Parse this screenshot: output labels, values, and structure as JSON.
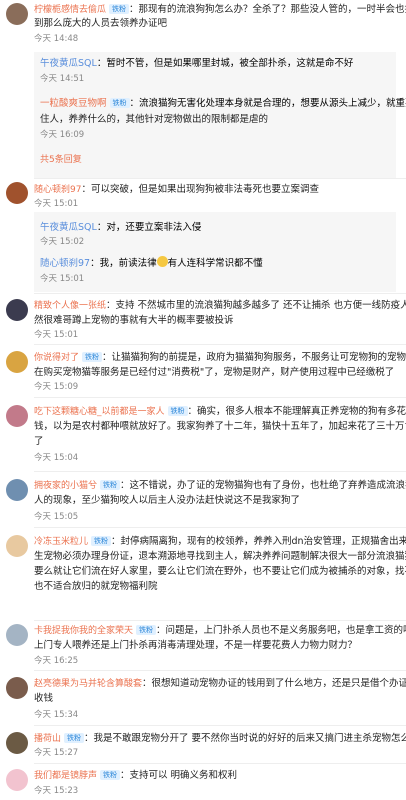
{
  "comments": [
    {
      "user": "柠檬栀感情去偷瓜",
      "badge": "铁粉",
      "lines": [
        "：那现有的流浪狗狗怎么办？全杀了？那些没人管的，一时半会也找不",
        "到那么庞大的人员去领养办证吧"
      ],
      "time": "今天 14:48",
      "replies": [
        {
          "user": "午夜黄瓜SQL",
          "badge": "",
          "lines": [
            "：暂时不管，但是如果哪里封城，被全部扑杀，这就是命不好"
          ],
          "time": "今天 14:51"
        },
        {
          "user": "一粒酸爽豆物啊",
          "badge": "铁粉",
          "lines": [
            "：流浪猫狗无害化处理本身就是合理的，想要从源头上减少，就重要是抓",
            "住人，养养什么的，其他针对宠物做出的限制都是虐的"
          ],
          "time": "今天 16:09"
        }
      ],
      "more": "共5条回复"
    },
    {
      "user": "随心顿刹97",
      "badge": "",
      "lines": [
        "：可以突破，但是如果出现狗狗被非法毒死也要立案调查"
      ],
      "time": "今天 15:01",
      "replies": [
        {
          "user": "午夜黄瓜SQL",
          "badge": "",
          "lines": [
            "：对，还要立案非法入侵"
          ],
          "time": "今天 15:02"
        },
        {
          "user": "随心顿刹97",
          "badge": "",
          "lines": [
            "：我，前读法律",
            "有人连科学常识都不懂"
          ],
          "time": "今天 15:01"
        }
      ]
    },
    {
      "user": "精致个人像一张纸",
      "badge": "",
      "lines": [
        "：支持 不然城市里的流浪猫狗越多越多了 还不让捕杀 也方便一线防疫人员 不",
        "然很难哥蹲上宠物的事就有大半的概率要被投诉"
      ],
      "time": "今天 15:01"
    },
    {
      "user": "你说得对了",
      "badge": "铁粉",
      "lines": [
        "：让猫猫狗狗的前提是，政府为猫猫狗狗服务，不服务让可宠物狗的宠物主人",
        "在购买宠物猫等服务是已经付过\"消费税\"了，宠物是财产，财产使用过程中已经缴税了"
      ],
      "time": "今天 15:09"
    },
    {
      "user": "吃下这颗糖心糖_以前都是一家人",
      "badge": "铁粉",
      "lines": [
        "：确实，很多人根本不能理解真正养宠物的狗有多花",
        "钱，以为是农村都种喂就放好了。我家狗养了十二年，猫快十五年了，加起来花了三十万肯定有",
        "了"
      ],
      "time": "今天 15:04"
    },
    {
      "user": "拥夜家的小猫兮",
      "badge": "铁粉",
      "lines": [
        "：这不错说，办了证的宠物猫狗也有了身份，也杜绝了弃养造成流浪猫狗伤",
        "人的现象，至少猫狗咬人以后主人没办法赶快说这不是我家狗了"
      ],
      "time": "今天 15:05"
    },
    {
      "user": "冷冻玉米粒儿",
      "badge": "铁粉",
      "lines": [
        "：封停病隔离狗，现有的校领养，养养入刑dn治安管理，正规猫舍出来的或者",
        "生宠物必须办理身份证，退本溯源地寻找到主人，解决养养问题制解决很大一部分流浪猫狗问题，",
        "要么就让它们流在好人家里，要么让它们流在野外，也不要让它们成为被捕杀的对象，找不到领养",
        "也不适合放归的就宠物福利院"
      ],
      "time": "今天 15:05"
    },
    {
      "user": "卡我捉我你我的全家荣天",
      "badge": "铁粉",
      "lines": [
        "：问题是，上门扑杀人员也不是义务服务吧，也是拿工资的吧，不管是和",
        "上门专人喂养还是上门扑杀再消毒清理处理，不是一样要花费人力物力财力？"
      ],
      "time": "今天 16:25"
    },
    {
      "user": "赵亮德果为马并轮含算酸套",
      "badge": "",
      "lines": [
        "：很想知道动宠物办证的钱用到了什么地方，还是只是借个办证的名目",
        "收钱"
      ],
      "time": "今天 15:34"
    },
    {
      "user": "播荷山",
      "badge": "铁粉",
      "lines": [
        "：我是不敢跟宠物分开了 要不然你当时说的好好的后来又搞门进主杀宠物怎么办"
      ],
      "time": "今天 15:27"
    },
    {
      "user": "我们都是镜脖声",
      "badge": "铁粉",
      "lines": [
        "：支持可以 明确义务和权利"
      ],
      "time": "今天 15:23"
    }
  ],
  "colors": {
    "username": "#eb7350",
    "reply_user": "#5b8fdc",
    "badge_bg": "#e0f0ff",
    "badge_text": "#2b86d8",
    "more": "#eb7350",
    "time": "#888888"
  }
}
